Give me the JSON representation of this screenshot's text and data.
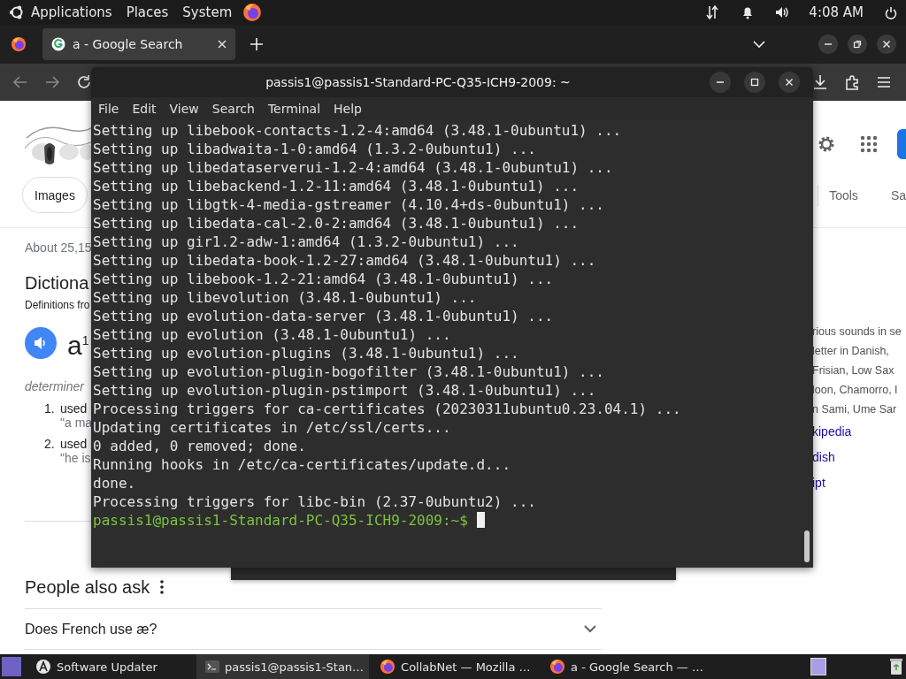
{
  "top_panel": {
    "menus": [
      "Applications",
      "Places",
      "System"
    ],
    "clock": "4:08 AM"
  },
  "browser": {
    "tabs": [
      {
        "label": "a - Google Search",
        "selected": true
      }
    ],
    "chips": [
      "Images"
    ],
    "search_tools": [
      "Tools",
      "Sa"
    ],
    "result_stats": "About 25,15",
    "dictionary": {
      "heading": "Dictiona",
      "source": "Definitions fro",
      "word": "a$^{1}$",
      "part_of_speech": "determiner",
      "senses": [
        {
          "number": "1.",
          "text": "used",
          "example": "\"a ma"
        },
        {
          "number": "2.",
          "text": "used",
          "example": "\"he is"
        }
      ]
    },
    "side_text": [
      {
        "text": "rious sounds in se",
        "kind": "text"
      },
      {
        "text": "letter in Danish,",
        "kind": "text"
      },
      {
        "text": "Frisian, Low Sax",
        "kind": "text"
      },
      {
        "text": "loon, Chamorro, I",
        "kind": "text"
      },
      {
        "text": "n Sami, Ume Sar",
        "kind": "text"
      },
      {
        "text": "kipedia",
        "kind": "link"
      },
      {
        "text": "dish",
        "kind": "link"
      },
      {
        "text": "ipt",
        "kind": "link"
      }
    ],
    "people_also_ask": {
      "heading": "People also ask",
      "questions": [
        {
          "text": "Does French use æ?",
          "expanded": false
        }
      ]
    }
  },
  "terminal": {
    "title": "passis1@passis1-Standard-PC-Q35-ICH9-2009: ~",
    "menus": [
      "File",
      "Edit",
      "View",
      "Search",
      "Terminal",
      "Help"
    ],
    "lines": [
      {
        "text": "Setting up libebook-contacts-1.2-4:amd64 (3.48.1-0ubuntu1) ...",
        "kind": "output"
      },
      {
        "text": "Setting up libadwaita-1-0:amd64 (1.3.2-0ubuntu1) ...",
        "kind": "output"
      },
      {
        "text": "Setting up libedataserverui-1.2-4:amd64 (3.48.1-0ubuntu1) ...",
        "kind": "output"
      },
      {
        "text": "Setting up libebackend-1.2-11:amd64 (3.48.1-0ubuntu1) ...",
        "kind": "output"
      },
      {
        "text": "Setting up libgtk-4-media-gstreamer (4.10.4+ds-0ubuntu1) ...",
        "kind": "output"
      },
      {
        "text": "Setting up libedata-cal-2.0-2:amd64 (3.48.1-0ubuntu1) ...",
        "kind": "output"
      },
      {
        "text": "Setting up gir1.2-adw-1:amd64 (1.3.2-0ubuntu1) ...",
        "kind": "output"
      },
      {
        "text": "Setting up libedata-book-1.2-27:amd64 (3.48.1-0ubuntu1) ...",
        "kind": "output"
      },
      {
        "text": "Setting up libebook-1.2-21:amd64 (3.48.1-0ubuntu1) ...",
        "kind": "output"
      },
      {
        "text": "Setting up libevolution (3.48.1-0ubuntu1) ...",
        "kind": "output"
      },
      {
        "text": "Setting up evolution-data-server (3.48.1-0ubuntu1) ...",
        "kind": "output"
      },
      {
        "text": "Setting up evolution (3.48.1-0ubuntu1) ...",
        "kind": "output"
      },
      {
        "text": "Setting up evolution-plugins (3.48.1-0ubuntu1) ...",
        "kind": "output"
      },
      {
        "text": "Setting up evolution-plugin-bogofilter (3.48.1-0ubuntu1) ...",
        "kind": "output"
      },
      {
        "text": "Setting up evolution-plugin-pstimport (3.48.1-0ubuntu1) ...",
        "kind": "output"
      },
      {
        "text": "Processing triggers for ca-certificates (20230311ubuntu0.23.04.1) ...",
        "kind": "output"
      },
      {
        "text": "Updating certificates in /etc/ssl/certs...",
        "kind": "output"
      },
      {
        "text": "0 added, 0 removed; done.",
        "kind": "output"
      },
      {
        "text": "Running hooks in /etc/ca-certificates/update.d...",
        "kind": "output"
      },
      {
        "text": "done.",
        "kind": "output"
      },
      {
        "text": "Processing triggers for libc-bin (2.37-0ubuntu2) ...",
        "kind": "output"
      },
      {
        "text": "passis1@passis1-Standard-PC-Q35-ICH9-2009:~$",
        "kind": "prompt"
      }
    ]
  },
  "taskbar": {
    "items": [
      {
        "label": "Software Updater",
        "kind": "updater",
        "selected": false
      },
      {
        "label": "passis1@passis1-Stan…",
        "kind": "terminal",
        "selected": true
      },
      {
        "label": "CollabNet — Mozilla …",
        "kind": "firefox",
        "selected": false
      },
      {
        "label": "a - Google Search — …",
        "kind": "firefox",
        "selected": false
      }
    ]
  }
}
